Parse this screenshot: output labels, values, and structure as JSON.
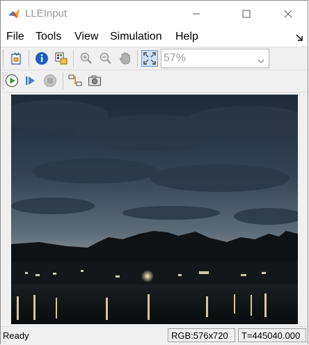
{
  "window": {
    "title": "LLEInput",
    "minimize_icon": "minimize-icon",
    "maximize_icon": "maximize-icon",
    "close_icon": "close-icon"
  },
  "menu": {
    "items": [
      "File",
      "Tools",
      "View",
      "Simulation",
      "Help"
    ]
  },
  "toolbar1": {
    "buttons": [
      "open-model-icon",
      "info-icon",
      "export-icon",
      "zoom-in-icon",
      "zoom-out-icon",
      "pan-hand-icon",
      "fit-to-window-icon"
    ],
    "zoom_value": "57%"
  },
  "toolbar2": {
    "buttons": [
      "run-icon",
      "step-forward-icon",
      "stop-icon",
      "highlight-model-icon",
      "snapshot-icon"
    ]
  },
  "image": {
    "description": "night lake landscape photo"
  },
  "status": {
    "ready": "Ready",
    "rgb": "RGB:576x720",
    "time": "T=445040.000"
  },
  "colors": {
    "accent": "#cce0f7",
    "run_green": "#2e9a2e",
    "info_blue": "#1d5fbf"
  }
}
